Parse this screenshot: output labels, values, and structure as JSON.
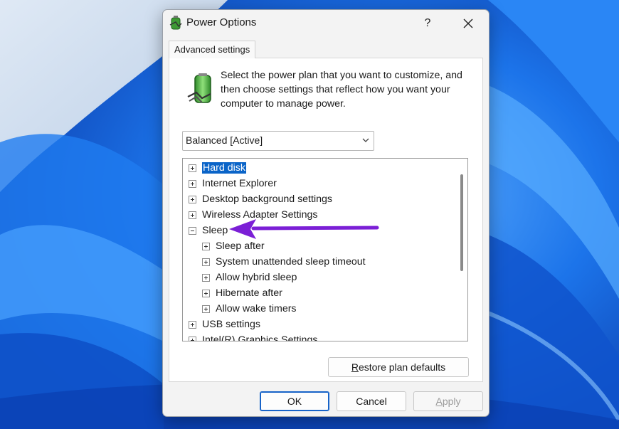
{
  "window": {
    "title": "Power Options",
    "help": "?",
    "close": "✕"
  },
  "tab": {
    "label": "Advanced settings"
  },
  "description": "Select the power plan that you want to customize, and then choose settings that reflect how you want your computer to manage power.",
  "plan_select": {
    "value": "Balanced [Active]"
  },
  "tree": {
    "items": [
      {
        "label": "Hard disk",
        "expander": "plus",
        "indent": 0,
        "selected": true
      },
      {
        "label": "Internet Explorer",
        "expander": "plus",
        "indent": 0
      },
      {
        "label": "Desktop background settings",
        "expander": "plus",
        "indent": 0
      },
      {
        "label": "Wireless Adapter Settings",
        "expander": "plus",
        "indent": 0
      },
      {
        "label": "Sleep",
        "expander": "minus",
        "indent": 0
      },
      {
        "label": "Sleep after",
        "expander": "plus",
        "indent": 1
      },
      {
        "label": "System unattended sleep timeout",
        "expander": "plus",
        "indent": 1
      },
      {
        "label": "Allow hybrid sleep",
        "expander": "plus",
        "indent": 1
      },
      {
        "label": "Hibernate after",
        "expander": "plus",
        "indent": 1
      },
      {
        "label": "Allow wake timers",
        "expander": "plus",
        "indent": 1
      },
      {
        "label": "USB settings",
        "expander": "plus",
        "indent": 0
      },
      {
        "label": "Intel(R) Graphics Settings",
        "expander": "plus",
        "indent": 0
      }
    ]
  },
  "buttons": {
    "restore_underline": "R",
    "restore_rest": "estore plan defaults",
    "ok": "OK",
    "cancel": "Cancel",
    "apply_underline": "A",
    "apply_rest": "pply"
  },
  "colors": {
    "selection": "#0a64c8",
    "annotation_arrow": "#7b1fd6",
    "wallpaper": "#1b6fe6"
  }
}
